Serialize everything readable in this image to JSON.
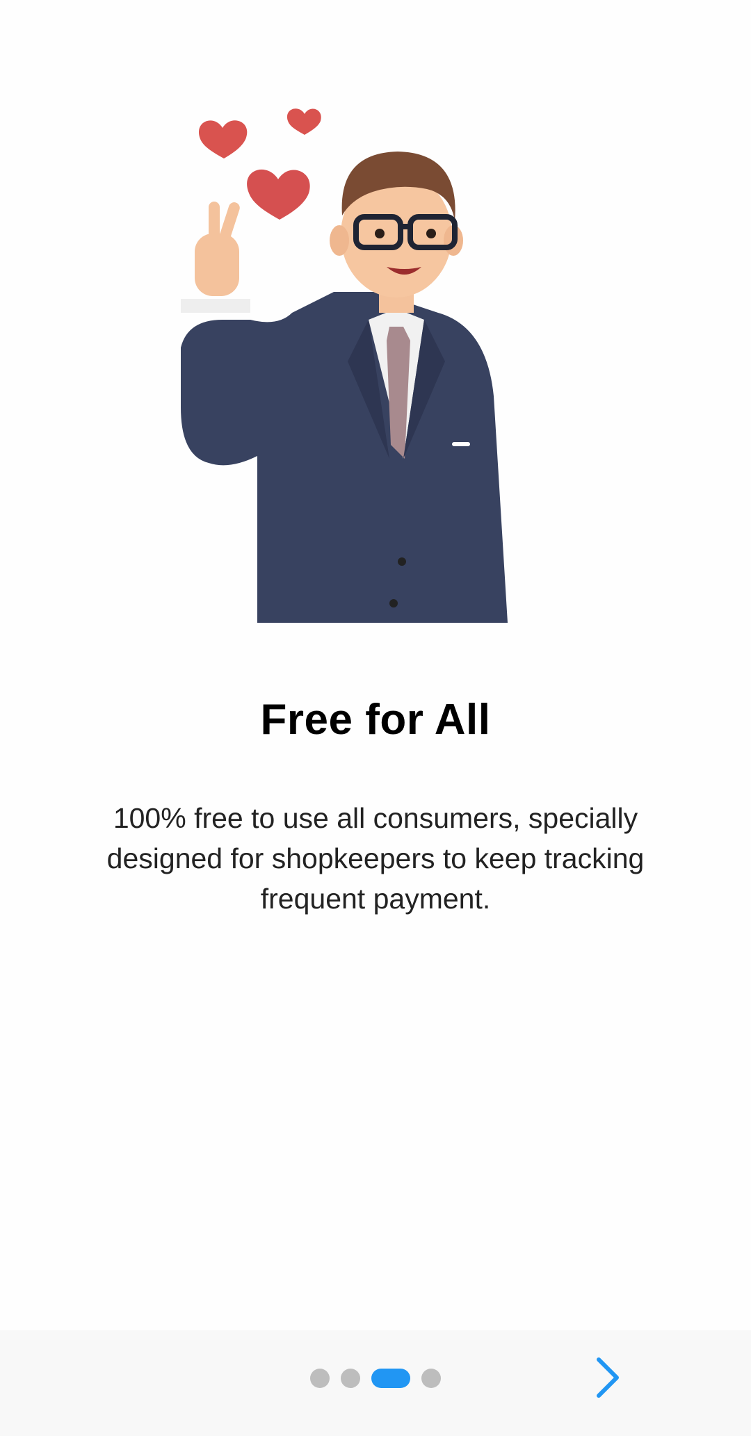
{
  "onboarding": {
    "title": "Free for All",
    "description": "100% free to use all consumers, specially designed for shopkeepers to keep tracking frequent payment.",
    "illustration_icon": "waving-businessman-illustration"
  },
  "pager": {
    "page_count": 4,
    "current_page": 3
  },
  "navigation": {
    "next_icon": "chevron-right-icon"
  },
  "colors": {
    "accent": "#2196f3",
    "dot_inactive": "#bdbdbd",
    "bottom_bar": "#f8f8f8",
    "heart": "#d9534f"
  }
}
